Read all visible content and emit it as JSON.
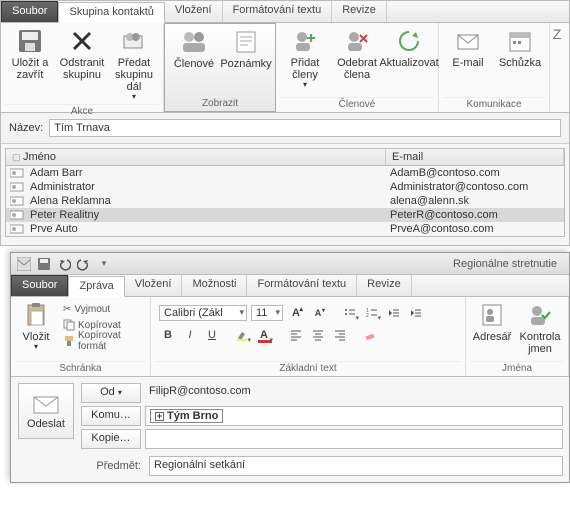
{
  "win1": {
    "tabs": [
      "Soubor",
      "Skupina kontaktů",
      "Vložení",
      "Formátování textu",
      "Revize"
    ],
    "active_tab": 1,
    "ribbon": {
      "akce": {
        "label": "Akce",
        "save": "Uložit a zavřít",
        "delete": "Odstranit skupinu",
        "forward": "Předat skupinu dál"
      },
      "zobrazit": {
        "label": "Zobrazit",
        "members": "Členové",
        "notes": "Poznámky"
      },
      "clenove": {
        "label": "Členové",
        "add": "Přidat členy",
        "remove": "Odebrat člena",
        "update": "Aktualizovat"
      },
      "komunikace": {
        "label": "Komunikace",
        "email": "E-mail",
        "meeting": "Schůzka"
      }
    },
    "name_label": "Název:",
    "name_value": "Tím Trnava",
    "columns": {
      "name": "Jméno",
      "email": "E-mail"
    },
    "rows": [
      {
        "name": "Adam Barr",
        "email": "AdamB@contoso.com",
        "sel": false
      },
      {
        "name": "Administrator",
        "email": "Administrator@contoso.com",
        "sel": false
      },
      {
        "name": "Alena Reklamna",
        "email": "alena@alenn.sk",
        "sel": false
      },
      {
        "name": "Peter Realitny",
        "email": "PeterR@contoso.com",
        "sel": true
      },
      {
        "name": "Prve Auto",
        "email": "PrveA@contoso.com",
        "sel": false
      }
    ]
  },
  "win2": {
    "title": "Regionálne stretnutie",
    "tabs": [
      "Soubor",
      "Zpráva",
      "Vložení",
      "Možnosti",
      "Formátování textu",
      "Revize"
    ],
    "active_tab": 1,
    "schranka": {
      "label": "Schránka",
      "paste": "Vložit",
      "cut": "Vyjmout",
      "copy": "Kopírovat",
      "painter": "Kopírovat formát"
    },
    "text": {
      "label": "Základní text",
      "font": "Calibri (Zákl",
      "size": "11"
    },
    "jmena": {
      "label": "Jména",
      "adresar": "Adresář",
      "kontrola": "Kontrola jmen"
    },
    "compose": {
      "send": "Odeslat",
      "from_btn": "Od",
      "from_val": "FilipR@contoso.com",
      "to_btn": "Komu…",
      "to_val": "Tým Brno",
      "cc_btn": "Kopie…",
      "cc_val": "",
      "subject_label": "Předmět:",
      "subject_val": "Regionální setkání"
    }
  }
}
